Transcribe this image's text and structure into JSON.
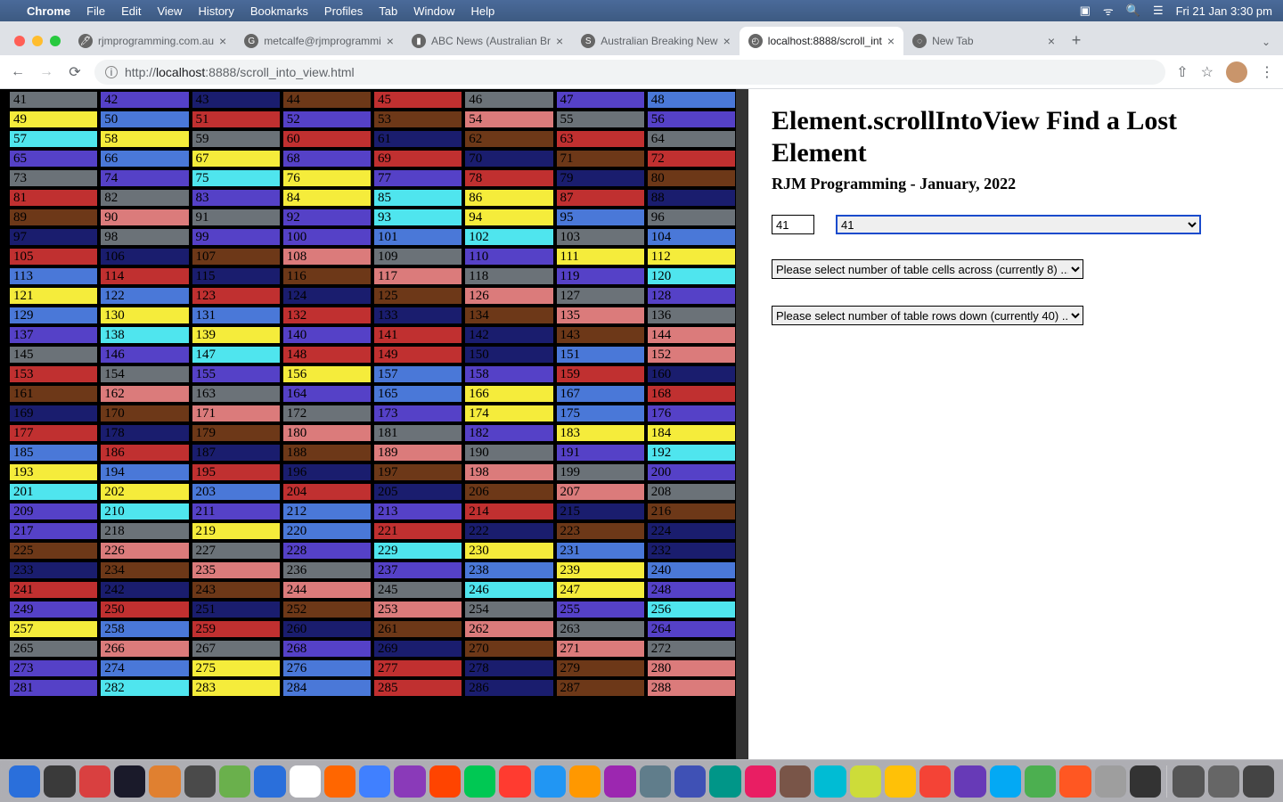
{
  "menubar": {
    "app": "Chrome",
    "items": [
      "File",
      "Edit",
      "View",
      "History",
      "Bookmarks",
      "Profiles",
      "Tab",
      "Window",
      "Help"
    ],
    "clock": "Fri 21 Jan  3:30 pm"
  },
  "tabs": [
    {
      "title": "rjmprogramming.com.au",
      "icon": "🖊"
    },
    {
      "title": "metcalfe@rjmprogrammi",
      "icon": "G"
    },
    {
      "title": "ABC News (Australian Br",
      "icon": "▮"
    },
    {
      "title": "Australian Breaking New",
      "icon": "S"
    },
    {
      "title": "localhost:8888/scroll_int",
      "icon": "◴",
      "active": true
    },
    {
      "title": "New Tab",
      "icon": "◌"
    }
  ],
  "url": {
    "proto": "http://",
    "host": "localhost",
    "port": ":8888",
    "path": "/scroll_into_view.html"
  },
  "page": {
    "heading": "Element.scrollIntoView Find a Lost Element",
    "sub": "RJM Programming - January, 2022",
    "input_value": "41",
    "select_value": "41",
    "cols_label": "Please select number of table cells across (currently 8) ...",
    "rows_label": "Please select number of table rows down (currently 40) ..."
  },
  "grid": {
    "start": 41,
    "end": 288,
    "cols": 8,
    "colors": [
      "c-gray",
      "c-indigo",
      "c-navy2",
      "c-brown",
      "c-red",
      "c-gray",
      "c-indigo",
      "c-blue",
      "c-yellow",
      "c-blue",
      "c-red",
      "c-indigo",
      "c-brown",
      "c-pink",
      "c-gray",
      "c-indigo",
      "c-cyan",
      "c-yellow",
      "c-gray",
      "c-red",
      "c-navy",
      "c-brown",
      "c-red",
      "c-gray",
      "c-indigo",
      "c-blue",
      "c-yellow",
      "c-indigo",
      "c-red",
      "c-navy",
      "c-brown",
      "c-red",
      "c-gray",
      "c-indigo",
      "c-cyan",
      "c-yellow",
      "c-indigo",
      "c-red",
      "c-navy",
      "c-brown",
      "c-red",
      "c-gray",
      "c-indigo",
      "c-yellow",
      "c-cyan",
      "c-yellow",
      "c-red",
      "c-navy",
      "c-brown",
      "c-pink",
      "c-gray",
      "c-indigo",
      "c-cyan",
      "c-yellow",
      "c-blue",
      "c-gray",
      "c-navy",
      "c-gray",
      "c-indigo",
      "c-indigo",
      "c-blue",
      "c-cyan",
      "c-gray",
      "c-blue",
      "c-red",
      "c-navy",
      "c-brown",
      "c-pink",
      "c-gray",
      "c-indigo",
      "c-yellow",
      "c-yellow",
      "c-blue",
      "c-red",
      "c-navy",
      "c-brown",
      "c-pink",
      "c-gray",
      "c-indigo",
      "c-cyan",
      "c-yellow",
      "c-blue",
      "c-red",
      "c-navy",
      "c-brown",
      "c-pink",
      "c-gray",
      "c-indigo",
      "c-blue",
      "c-yellow",
      "c-blue",
      "c-red",
      "c-navy",
      "c-brown",
      "c-pink",
      "c-gray",
      "c-indigo",
      "c-cyan",
      "c-yellow",
      "c-indigo",
      "c-red",
      "c-navy",
      "c-brown",
      "c-pink",
      "c-gray",
      "c-indigo",
      "c-cyan",
      "c-red",
      "c-red",
      "c-navy",
      "c-blue",
      "c-pink",
      "c-red",
      "c-gray",
      "c-indigo",
      "c-yellow",
      "c-blue",
      "c-indigo",
      "c-red",
      "c-navy",
      "c-brown",
      "c-pink",
      "c-gray",
      "c-indigo",
      "c-blue",
      "c-yellow",
      "c-blue",
      "c-red",
      "c-navy",
      "c-brown",
      "c-pink",
      "c-gray",
      "c-indigo",
      "c-yellow",
      "c-blue",
      "c-indigo",
      "c-red",
      "c-navy",
      "c-brown",
      "c-pink",
      "c-gray",
      "c-indigo",
      "c-yellow",
      "c-yellow",
      "c-blue",
      "c-red",
      "c-navy",
      "c-brown",
      "c-pink",
      "c-gray",
      "c-indigo",
      "c-cyan",
      "c-yellow",
      "c-blue",
      "c-red",
      "c-navy",
      "c-brown",
      "c-pink",
      "c-gray",
      "c-indigo",
      "c-cyan",
      "c-yellow",
      "c-blue",
      "c-red",
      "c-navy",
      "c-brown",
      "c-pink",
      "c-gray",
      "c-indigo",
      "c-cyan",
      "c-indigo",
      "c-blue",
      "c-indigo",
      "c-red",
      "c-navy",
      "c-brown",
      "c-indigo",
      "c-gray",
      "c-yellow",
      "c-blue",
      "c-red",
      "c-navy",
      "c-brown",
      "c-navy",
      "c-brown",
      "c-pink",
      "c-gray",
      "c-indigo",
      "c-cyan",
      "c-yellow",
      "c-blue",
      "c-navy",
      "c-navy",
      "c-brown",
      "c-pink",
      "c-gray",
      "c-indigo",
      "c-blue",
      "c-yellow",
      "c-blue",
      "c-red",
      "c-navy",
      "c-brown",
      "c-pink",
      "c-gray",
      "c-cyan",
      "c-yellow",
      "c-indigo",
      "c-indigo",
      "c-red",
      "c-navy",
      "c-brown",
      "c-pink",
      "c-gray",
      "c-indigo",
      "c-cyan",
      "c-yellow",
      "c-blue",
      "c-red",
      "c-navy",
      "c-brown",
      "c-pink",
      "c-gray",
      "c-indigo",
      "c-gray",
      "c-pink",
      "c-gray",
      "c-indigo",
      "c-navy",
      "c-brown",
      "c-pink",
      "c-gray",
      "c-indigo",
      "c-blue",
      "c-yellow",
      "c-blue",
      "c-red",
      "c-navy",
      "c-brown",
      "c-pink",
      "c-indigo",
      "c-cyan",
      "c-yellow",
      "c-blue",
      "c-red",
      "c-navy",
      "c-brown",
      "c-pink"
    ]
  },
  "dock_icons": [
    "#2a6fdb",
    "#3a3a3a",
    "#d94040",
    "#1a1a2a",
    "#e08030",
    "#4a4a4a",
    "#6ab04c",
    "#2a6fdb",
    "#ffffff",
    "#ff6600",
    "#4080ff",
    "#8a3ab9",
    "#ff4400",
    "#00c853",
    "#ff3b30",
    "#2196f3",
    "#ff9800",
    "#9c27b0",
    "#607d8b",
    "#3f51b5",
    "#009688",
    "#e91e63",
    "#795548",
    "#00bcd4",
    "#cddc39",
    "#ffc107",
    "#f44336",
    "#673ab7",
    "#03a9f4",
    "#4caf50",
    "#ff5722",
    "#9e9e9e",
    "#333333"
  ]
}
